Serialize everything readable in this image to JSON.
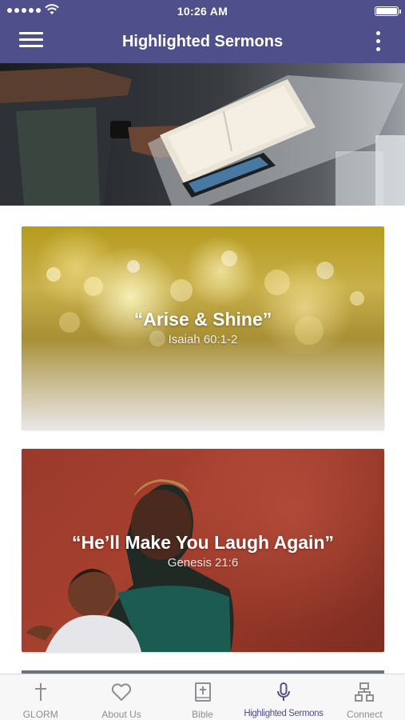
{
  "status_bar": {
    "time": "10:26 AM"
  },
  "nav": {
    "title": "Highlighted Sermons",
    "menu_icon": "hamburger-menu-icon",
    "more_icon": "vertical-ellipsis-icon"
  },
  "sermons": [
    {
      "title": "“Arise & Shine”",
      "reference": "Isaiah 60:1-2"
    },
    {
      "title": "“He’ll Make You Laugh Again”",
      "reference": "Genesis 21:6"
    }
  ],
  "tabs": [
    {
      "label": "GLORM",
      "icon": "cross-icon",
      "active": false
    },
    {
      "label": "About Us",
      "icon": "heart-icon",
      "active": false
    },
    {
      "label": "Bible",
      "icon": "bible-book-icon",
      "active": false
    },
    {
      "label": "Highlighted Sermons",
      "icon": "microphone-icon",
      "active": true
    },
    {
      "label": "Connect",
      "icon": "network-icon",
      "active": false
    }
  ],
  "colors": {
    "nav_background": "#4f4f8c",
    "tab_active": "#4f4f8c",
    "tab_inactive": "#8e8e93"
  }
}
